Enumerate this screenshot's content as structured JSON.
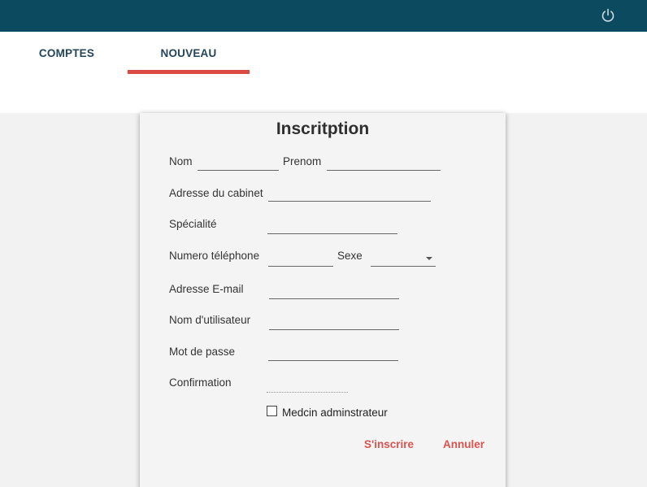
{
  "header": {
    "power_icon": "power-icon"
  },
  "tabs": [
    {
      "label": "COMPTES"
    },
    {
      "label": "NOUVEAU"
    }
  ],
  "form": {
    "title": "Inscritption",
    "labels": {
      "nom": "Nom",
      "prenom": "Prenom",
      "adresse_cabinet": "Adresse du cabinet",
      "specialite": "Spécialité",
      "telephone": "Numero téléphone",
      "sexe": "Sexe",
      "email": "Adresse E-mail",
      "utilisateur": "Nom d'utilisateur",
      "mot_de_passe": "Mot de passe",
      "confirmation": "Confirmation"
    },
    "checkbox_label": "Medcin adminstrateur",
    "submit_label": "S'inscrire",
    "cancel_label": "Annuler"
  },
  "colors": {
    "topbar": "#0b4a5f",
    "accent": "#dc4b43",
    "tab_text": "#23445a"
  }
}
